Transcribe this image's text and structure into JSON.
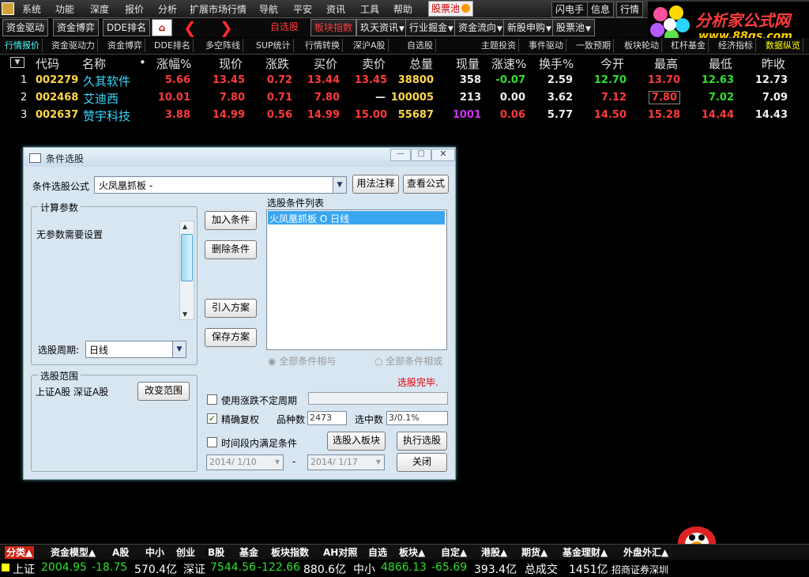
{
  "menu": [
    "系统",
    "功能",
    "深度",
    "报价",
    "分析",
    "扩展市场行情",
    "导航",
    "平安",
    "资讯",
    "工具",
    "帮助"
  ],
  "menu_highlight": "股票池",
  "top_right": [
    "闪电手",
    "信息",
    "行情"
  ],
  "toolbar": {
    "left": [
      "资金驱动",
      "资金博弈",
      "DDE排名"
    ],
    "mid": [
      "自选股",
      "板块指数",
      "玖天资讯",
      "行业掘金",
      "资金流向",
      "新股申购",
      "股票池"
    ]
  },
  "tabs": [
    "行情报价",
    "资金驱动力",
    "资金博弈",
    "DDE排名",
    "多空阵线",
    "SUP统计",
    "行情转换",
    "深沪A股",
    "自选股",
    "主题投资",
    "事件驱动",
    "一致预期",
    "板块轮动",
    "杠杆基金",
    "经济指标",
    "数据纵览"
  ],
  "logo": {
    "title": "分析家公式网",
    "url": "www.88gs.com"
  },
  "table": {
    "headers": [
      "代码",
      "名称",
      "•",
      "涨幅%",
      "现价",
      "涨跌",
      "买价",
      "卖价",
      "总量",
      "现量",
      "涨速%",
      "换手%",
      "今开",
      "最高",
      "最低",
      "昨收"
    ],
    "rows": [
      {
        "idx": "1",
        "code": "002279",
        "name": "久其软件",
        "pct": "5.66",
        "price": "13.45",
        "chg": "0.72",
        "bid": "13.44",
        "ask": "13.45",
        "vol": "38800",
        "cur": "358",
        "spd": "-0.07",
        "turn": "2.59",
        "open": "12.70",
        "high": "13.70",
        "low": "12.63",
        "prev": "12.73"
      },
      {
        "idx": "2",
        "code": "002468",
        "name": "艾迪西",
        "pct": "10.01",
        "price": "7.80",
        "chg": "0.71",
        "bid": "7.80",
        "ask": "—",
        "vol": "100005",
        "cur": "213",
        "spd": "0.00",
        "turn": "3.62",
        "open": "7.12",
        "high": "7.80",
        "low": "7.02",
        "prev": "7.09"
      },
      {
        "idx": "3",
        "code": "002637",
        "name": "赞宇科技",
        "pct": "3.88",
        "price": "14.99",
        "chg": "0.56",
        "bid": "14.99",
        "ask": "15.00",
        "vol": "55687",
        "cur": "1001",
        "spd": "0.06",
        "turn": "5.77",
        "open": "14.50",
        "high": "15.28",
        "low": "14.44",
        "prev": "14.43"
      }
    ]
  },
  "dialog": {
    "title": "条件选股",
    "formula_label": "条件选股公式",
    "formula_value": "火凤凰抓板 -",
    "btn_usage": "用法注释",
    "btn_view": "查看公式",
    "params_group": "计算参数",
    "params_text": "无参数需要设置",
    "period_label": "选股周期:",
    "period_value": "日线",
    "range_group": "选股范围",
    "range_text": "上证A股 深证A股",
    "btn_change_range": "改变范围",
    "btn_add": "加入条件",
    "btn_delete": "删除条件",
    "btn_import": "引入方案",
    "btn_save": "保存方案",
    "list_label": "选股条件列表",
    "list_item": "火凤凰抓板  O  日线",
    "radio_and": "全部条件相与",
    "radio_or": "全部条件相或",
    "status": "选股完毕.",
    "chk_uncertain": "使用涨跌不定周期",
    "chk_exact": "精确复权",
    "count_label": "品种数",
    "count_value": "2473",
    "selected_label": "选中数",
    "selected_value": "3/0.1%",
    "chk_period": "时间段内满足条件",
    "btn_to_block": "选股入板块",
    "btn_execute": "执行选股",
    "date_from": "2014/ 1/10",
    "date_sep": "-",
    "date_to": "2014/ 1/17",
    "btn_close": "关闭"
  },
  "bottom_tabs": [
    "分类▲",
    "资金模型▲",
    "A股",
    "中小",
    "创业",
    "B股",
    "基金",
    "板块指数",
    "AH对照",
    "自选",
    "板块▲",
    "自定▲",
    "港股▲",
    "期货▲",
    "基金理财▲",
    "外盘外汇▲"
  ],
  "status_bar": {
    "sh_label": "上证",
    "sh_val": "2004.95",
    "sh_chg": "-18.75",
    "sh_amt": "570.4亿",
    "sz_label": "深证",
    "sz_val": "7544.56",
    "sz_chg": "-122.66",
    "sz_amt": "880.6亿",
    "zx_label": "中小",
    "zx_val": "4866.13",
    "zx_chg": "-65.69",
    "zx_amt": "393.4亿",
    "total_label": "总成交",
    "total_amt": "1451亿",
    "broker": "招商证券深圳"
  },
  "colors": {
    "up": "#ff3b3b",
    "down": "#2ee02e",
    "code": "#ffd84a",
    "name": "#38d7ff"
  }
}
